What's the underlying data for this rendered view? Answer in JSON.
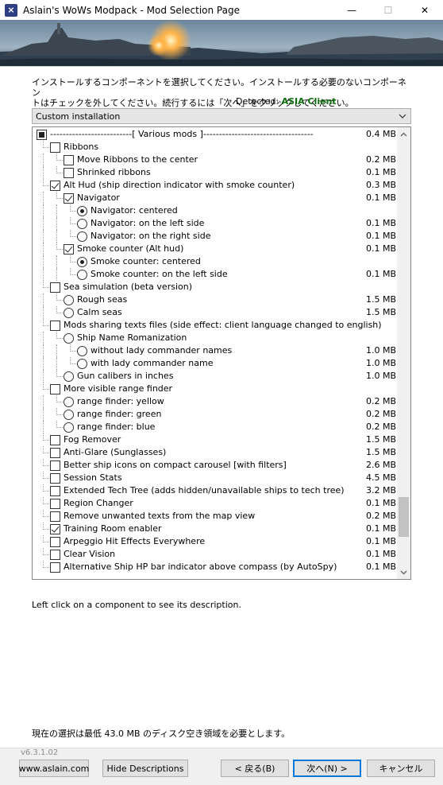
{
  "window": {
    "title": "Aslain's WoWs Modpack - Mod Selection Page",
    "minimize": "—",
    "maximize": "☐",
    "close": "✕",
    "icon": "modpack-app-icon"
  },
  "page": {
    "instruction_line1": "インストールするコンポーネントを選択してください。インストールする必要のないコンポーネン",
    "instruction_line2": "トはチェックを外してください。続行するには「次へ」をクリックしてください。",
    "detected_label": "Detected:",
    "detected_value": "ASIA Client",
    "install_type": "Custom installation",
    "hint": "Left click on a component to see its description.",
    "space_note": "現在の選択は最低 43.0 MB のディスク空き領域を必要とします。",
    "version": "v6.3.1.02"
  },
  "components": [
    {
      "label": "--------------------------[ Various mods ]-----------------------------------",
      "size": "0.4 MB",
      "level": 0,
      "control": "checkbox",
      "state": "partial"
    },
    {
      "label": "Ribbons",
      "size": "",
      "level": 1,
      "control": "checkbox",
      "state": "unchecked"
    },
    {
      "label": "Move Ribbons to the center",
      "size": "0.2 MB",
      "level": 2,
      "control": "checkbox",
      "state": "unchecked"
    },
    {
      "label": "Shrinked ribbons",
      "size": "0.1 MB",
      "level": 2,
      "control": "checkbox",
      "state": "unchecked"
    },
    {
      "label": "Alt Hud (ship direction indicator with smoke counter)",
      "size": "0.3 MB",
      "level": 1,
      "control": "checkbox",
      "state": "checked"
    },
    {
      "label": "Navigator",
      "size": "0.1 MB",
      "level": 2,
      "control": "checkbox",
      "state": "checked"
    },
    {
      "label": "Navigator: centered",
      "size": "",
      "level": 3,
      "control": "radio",
      "state": "checked"
    },
    {
      "label": "Navigator: on the left side",
      "size": "0.1 MB",
      "level": 3,
      "control": "radio",
      "state": "unchecked"
    },
    {
      "label": "Navigator: on the right side",
      "size": "0.1 MB",
      "level": 3,
      "control": "radio",
      "state": "unchecked"
    },
    {
      "label": "Smoke counter (Alt hud)",
      "size": "0.1 MB",
      "level": 2,
      "control": "checkbox",
      "state": "checked"
    },
    {
      "label": "Smoke counter: centered",
      "size": "",
      "level": 3,
      "control": "radio",
      "state": "checked"
    },
    {
      "label": "Smoke counter: on the left side",
      "size": "0.1 MB",
      "level": 3,
      "control": "radio",
      "state": "unchecked"
    },
    {
      "label": "Sea simulation (beta version)",
      "size": "",
      "level": 1,
      "control": "checkbox",
      "state": "unchecked"
    },
    {
      "label": "Rough seas",
      "size": "1.5 MB",
      "level": 2,
      "control": "radio",
      "state": "unchecked"
    },
    {
      "label": "Calm seas",
      "size": "1.5 MB",
      "level": 2,
      "control": "radio",
      "state": "unchecked"
    },
    {
      "label": "Mods sharing texts files (side effect: client language changed to english)",
      "size": "",
      "level": 1,
      "control": "checkbox",
      "state": "unchecked"
    },
    {
      "label": "Ship Name Romanization",
      "size": "",
      "level": 2,
      "control": "radio",
      "state": "unchecked"
    },
    {
      "label": "without lady commander names",
      "size": "1.0 MB",
      "level": 3,
      "control": "radio",
      "state": "unchecked"
    },
    {
      "label": "with lady commander name",
      "size": "1.0 MB",
      "level": 3,
      "control": "radio",
      "state": "unchecked"
    },
    {
      "label": "Gun calibers in inches",
      "size": "1.0 MB",
      "level": 2,
      "control": "radio",
      "state": "unchecked"
    },
    {
      "label": "More visible range finder",
      "size": "",
      "level": 1,
      "control": "checkbox",
      "state": "unchecked"
    },
    {
      "label": "range finder: yellow",
      "size": "0.2 MB",
      "level": 2,
      "control": "radio",
      "state": "unchecked"
    },
    {
      "label": "range finder: green",
      "size": "0.2 MB",
      "level": 2,
      "control": "radio",
      "state": "unchecked"
    },
    {
      "label": "range finder: blue",
      "size": "0.2 MB",
      "level": 2,
      "control": "radio",
      "state": "unchecked"
    },
    {
      "label": "Fog Remover",
      "size": "1.5 MB",
      "level": 1,
      "control": "checkbox",
      "state": "unchecked"
    },
    {
      "label": "Anti-Glare (Sunglasses)",
      "size": "1.5 MB",
      "level": 1,
      "control": "checkbox",
      "state": "unchecked"
    },
    {
      "label": "Better ship icons on compact carousel [with filters]",
      "size": "2.6 MB",
      "level": 1,
      "control": "checkbox",
      "state": "unchecked"
    },
    {
      "label": "Session Stats",
      "size": "4.5 MB",
      "level": 1,
      "control": "checkbox",
      "state": "unchecked"
    },
    {
      "label": "Extended Tech Tree (adds hidden/unavailable ships to tech tree)",
      "size": "3.2 MB",
      "level": 1,
      "control": "checkbox",
      "state": "unchecked"
    },
    {
      "label": "Region Changer",
      "size": "0.1 MB",
      "level": 1,
      "control": "checkbox",
      "state": "unchecked"
    },
    {
      "label": "Remove unwanted texts from the map view",
      "size": "0.2 MB",
      "level": 1,
      "control": "checkbox",
      "state": "unchecked"
    },
    {
      "label": "Training Room enabler",
      "size": "0.1 MB",
      "level": 1,
      "control": "checkbox",
      "state": "checked"
    },
    {
      "label": "Arpeggio Hit Effects Everywhere",
      "size": "0.1 MB",
      "level": 1,
      "control": "checkbox",
      "state": "unchecked"
    },
    {
      "label": "Clear Vision",
      "size": "0.1 MB",
      "level": 1,
      "control": "checkbox",
      "state": "unchecked"
    },
    {
      "label": "Alternative Ship HP bar indicator above compass (by AutoSpy)",
      "size": "0.1 MB",
      "level": 1,
      "control": "checkbox",
      "state": "unchecked"
    }
  ],
  "scroll": {
    "up_icon": "▲",
    "down_icon": "▼",
    "position_fraction": 0.82
  },
  "buttons": {
    "website": "www.aslain.com",
    "hide_descriptions": "Hide Descriptions",
    "back": "< 戻る(B)",
    "next": "次へ(N) >",
    "cancel": "キャンセル"
  },
  "colors": {
    "detected_value": "#0f6f0f",
    "focus": "#0078d7"
  }
}
